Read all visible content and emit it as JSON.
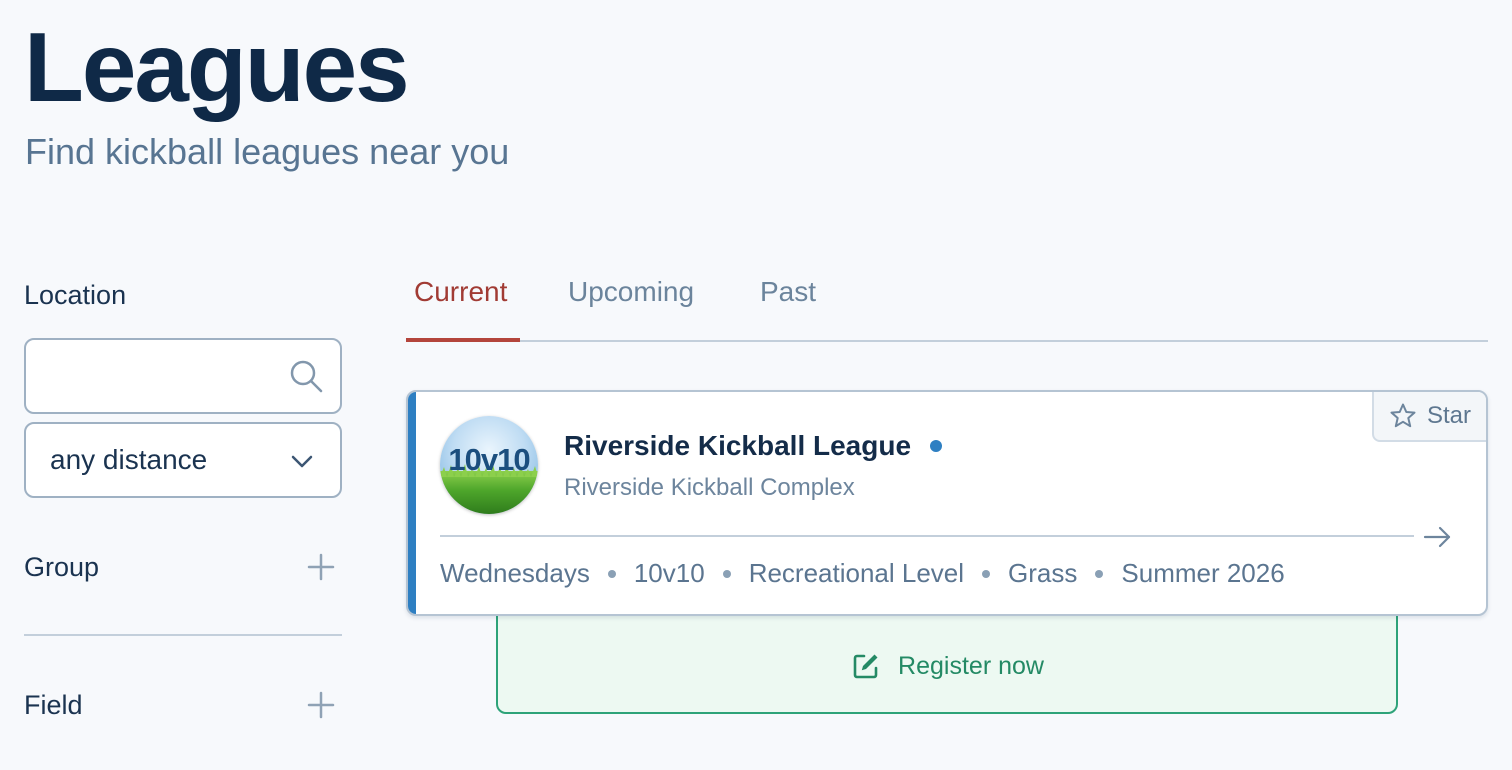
{
  "header": {
    "title": "Leagues",
    "subtitle": "Find kickball leagues near you"
  },
  "sidebar": {
    "location_label": "Location",
    "search": {
      "placeholder": "",
      "value": ""
    },
    "distance_select": {
      "selected": "any distance"
    },
    "sections": [
      {
        "label": "Group"
      },
      {
        "label": "Field"
      }
    ]
  },
  "tabs": [
    {
      "label": "Current",
      "active": true
    },
    {
      "label": "Upcoming",
      "active": false
    },
    {
      "label": "Past",
      "active": false
    }
  ],
  "leagues": [
    {
      "logo_text": "10v10",
      "name": "Riverside Kickball League",
      "venue": "Riverside Kickball Complex",
      "star_label": "Star",
      "meta": [
        "Wednesdays",
        "10v10",
        "Recreational Level",
        "Grass",
        "Summer 2026"
      ],
      "register_label": "Register now"
    }
  ],
  "colors": {
    "background": "#f7f9fc",
    "title": "#0f2947",
    "active_tab": "#a13b34",
    "card_accent": "#2e7fc2",
    "register_green": "#248a65",
    "register_bg": "#edf9f2"
  },
  "icons": {
    "search": "search-icon",
    "chevron": "chevron-down-icon",
    "plus": "plus-icon",
    "star": "star-icon",
    "arrow": "arrow-right-icon",
    "edit": "edit-icon"
  }
}
